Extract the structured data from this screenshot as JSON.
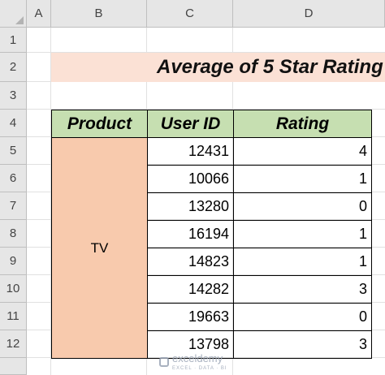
{
  "columns": [
    "A",
    "B",
    "C",
    "D"
  ],
  "rows": [
    "1",
    "2",
    "3",
    "4",
    "5",
    "6",
    "7",
    "8",
    "9",
    "10",
    "11",
    "12"
  ],
  "title": "Average of 5 Star Rating",
  "table": {
    "headers": {
      "product": "Product",
      "user_id": "User ID",
      "rating": "Rating"
    },
    "product": "TV",
    "records": [
      {
        "user_id": "12431",
        "rating": "4"
      },
      {
        "user_id": "10066",
        "rating": "1"
      },
      {
        "user_id": "13280",
        "rating": "0"
      },
      {
        "user_id": "16194",
        "rating": "1"
      },
      {
        "user_id": "14823",
        "rating": "1"
      },
      {
        "user_id": "14282",
        "rating": "3"
      },
      {
        "user_id": "19663",
        "rating": "0"
      },
      {
        "user_id": "13798",
        "rating": "3"
      }
    ]
  },
  "watermark": {
    "name": "exceldemy",
    "tagline": "EXCEL · DATA · BI"
  },
  "colors": {
    "title_fill": "#fbe1d5",
    "header_fill": "#c6dfb1",
    "product_fill": "#f8caad"
  }
}
